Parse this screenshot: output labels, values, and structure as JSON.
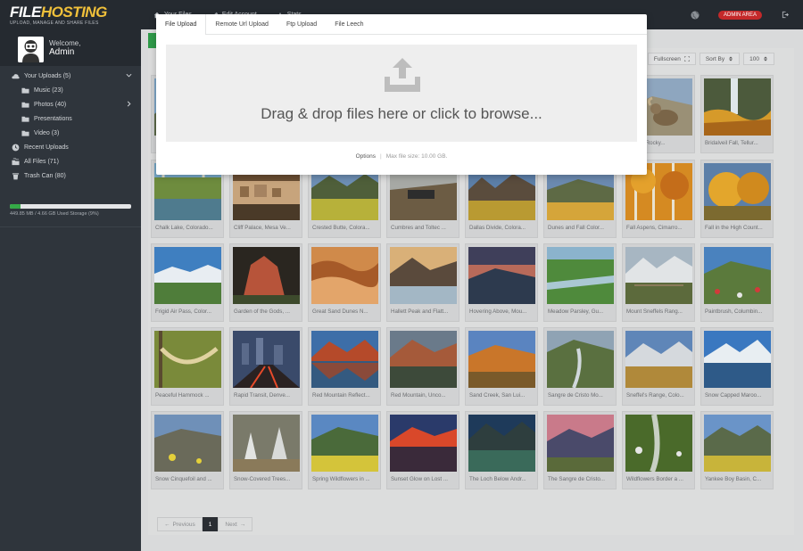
{
  "brand": {
    "logo_primary": "FILE",
    "logo_secondary": "HOSTING",
    "tagline": "UPLOAD, MANAGE AND SHARE FILES",
    "primary_color": "#f0c03a"
  },
  "topnav": {
    "items": [
      {
        "label": "Your Files",
        "icon": "home-icon"
      },
      {
        "label": "Edit Account",
        "icon": "pencil-icon"
      },
      {
        "label": "Stats",
        "icon": "chart-icon"
      }
    ],
    "admin_label": "ADMIN AREA"
  },
  "sidebar": {
    "welcome": "Welcome,",
    "username": "Admin",
    "items": [
      {
        "label": "Your Uploads (5)",
        "icon": "cloud-icon"
      },
      {
        "label": "Music (23)",
        "icon": "folder-icon"
      },
      {
        "label": "Photos (40)",
        "icon": "folder-icon"
      },
      {
        "label": "Presentations",
        "icon": "folder-icon"
      },
      {
        "label": "Video (3)",
        "icon": "folder-icon"
      },
      {
        "label": "Recent Uploads",
        "icon": "clock-icon"
      },
      {
        "label": "All Files (71)",
        "icon": "files-icon"
      },
      {
        "label": "Trash Can (80)",
        "icon": "trash-icon"
      }
    ],
    "storage_text": "449.85 MB / 4.66 GB Used Storage (9%)",
    "storage_percent": 9
  },
  "toolbar": {
    "fullscreen": "Fullscreen",
    "sort": "Sort By",
    "per_page": "100"
  },
  "modal": {
    "tabs": [
      "File Upload",
      "Remote Url Upload",
      "Ftp Upload",
      "File Leech"
    ],
    "drop_text": "Drag & drop files here or click to browse...",
    "options": "Options",
    "max_size": "Max file size: 10.00 GB."
  },
  "files": [
    {
      "name": "",
      "scene": "mtn"
    },
    {
      "name": "",
      "scene": "mtn"
    },
    {
      "name": "",
      "scene": "mtn"
    },
    {
      "name": "",
      "scene": "mtn"
    },
    {
      "name": "",
      "scene": "mtn"
    },
    {
      "name": "",
      "scene": "mtn"
    },
    {
      "name": "n Ram, Rocky...",
      "scene": "ram"
    },
    {
      "name": "Bridalveil Fall, Tellur...",
      "scene": "fall"
    },
    {
      "name": "Chalk Lake, Colorado...",
      "scene": "lake"
    },
    {
      "name": "Cliff Palace, Mesa Ve...",
      "scene": "cliff"
    },
    {
      "name": "Crested Butte, Colora...",
      "scene": "meadow"
    },
    {
      "name": "Cumbres and Toltec ...",
      "scene": "train"
    },
    {
      "name": "Dallas Divide, Colora...",
      "scene": "divide"
    },
    {
      "name": "Dunes and Fall Color...",
      "scene": "dunesfall"
    },
    {
      "name": "Fall Aspens, Cimarro...",
      "scene": "aspen"
    },
    {
      "name": "Fall in the High Count...",
      "scene": "aspen2"
    },
    {
      "name": "Frigid Air Pass, Color...",
      "scene": "pass"
    },
    {
      "name": "Garden of the Gods, ...",
      "scene": "gods"
    },
    {
      "name": "Great Sand Dunes N...",
      "scene": "dunes"
    },
    {
      "name": "Hallett Peak and Flatt...",
      "scene": "hallett"
    },
    {
      "name": "Hovering Above, Mou...",
      "scene": "hover"
    },
    {
      "name": "Meadow Parsley, Gu...",
      "scene": "parsley"
    },
    {
      "name": "Mount Sneffels Rang...",
      "scene": "sneffels"
    },
    {
      "name": "Paintbrush, Columbin...",
      "scene": "paint"
    },
    {
      "name": "Peaceful Hammock ...",
      "scene": "hammock"
    },
    {
      "name": "Rapid Transit, Denve...",
      "scene": "city"
    },
    {
      "name": "Red Mountain Reflect...",
      "scene": "redref"
    },
    {
      "name": "Red Mountain, Unco...",
      "scene": "redmtn"
    },
    {
      "name": "Sand Creek, San Lui...",
      "scene": "sand"
    },
    {
      "name": "Sangre de Cristo Mo...",
      "scene": "creek"
    },
    {
      "name": "Sneffel's Range, Colo...",
      "scene": "sneffels2"
    },
    {
      "name": "Snow Capped Maroo...",
      "scene": "maroon"
    },
    {
      "name": "Snow Cinquefoil and ...",
      "scene": "cinq"
    },
    {
      "name": "Snow-Covered Trees...",
      "scene": "snowtree"
    },
    {
      "name": "Spring Wildflowers in ...",
      "scene": "spring"
    },
    {
      "name": "Sunset Glow on Lost ...",
      "scene": "sunset"
    },
    {
      "name": "The Loch Below Andr...",
      "scene": "loch"
    },
    {
      "name": "The Sangre de Cristo...",
      "scene": "sangre"
    },
    {
      "name": "Wildflowers Border a ...",
      "scene": "stream"
    },
    {
      "name": "Yankee Boy Basin, C...",
      "scene": "yankee"
    }
  ],
  "pagination": {
    "prev": "Previous",
    "current": "1",
    "next": "Next"
  }
}
